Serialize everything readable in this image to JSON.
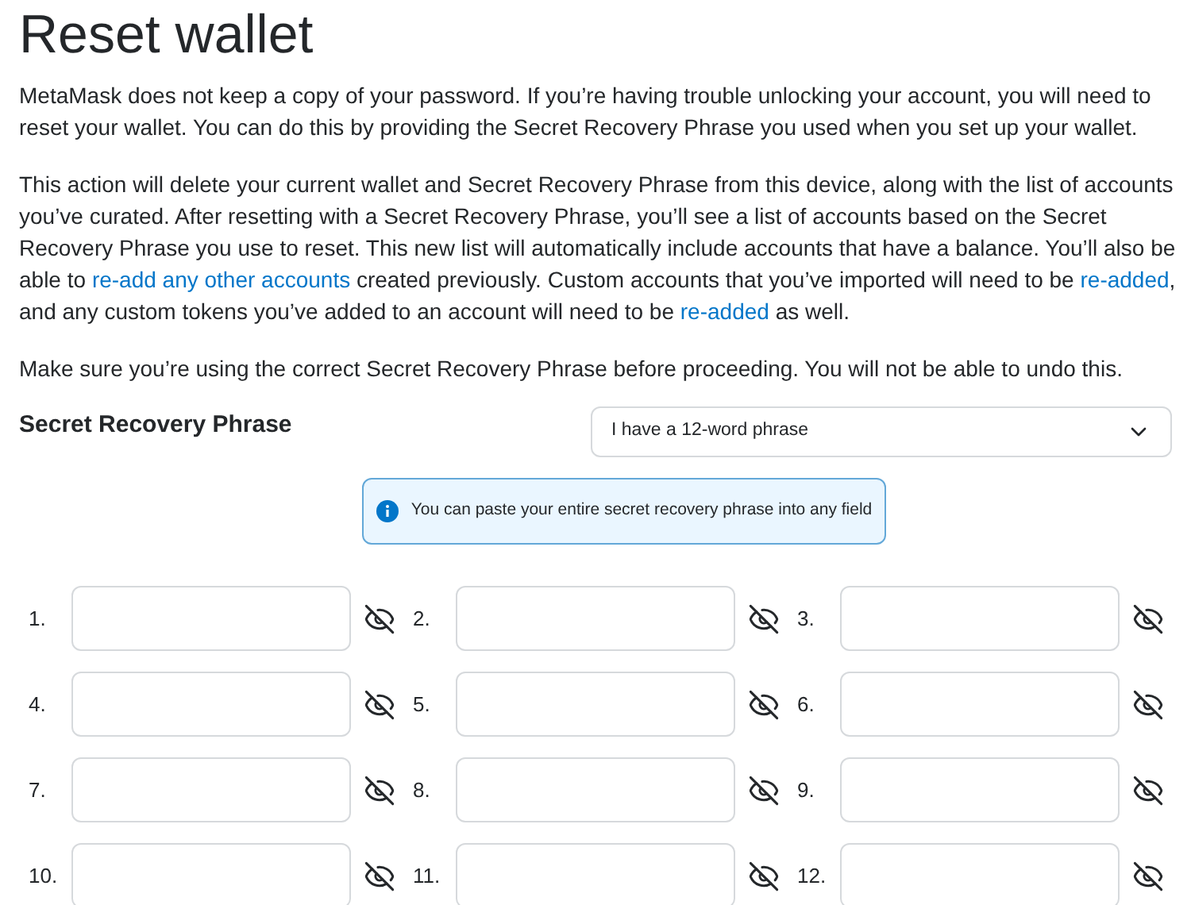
{
  "title": "Reset wallet",
  "paragraphs": [
    [
      {
        "text": "MetaMask does not keep a copy of your password. If you’re having trouble unlocking your account, you will need to reset your wallet. You can do this by providing the Secret Recovery Phrase you used when you set up your wallet.",
        "link": false
      }
    ],
    [
      {
        "text": "This action will delete your current wallet and Secret Recovery Phrase from this device, along with the list of accounts you’ve curated. After resetting with a Secret Recovery Phrase, you’ll see a list of accounts based on the Secret Recovery Phrase you use to reset. This new list will automatically include accounts that have a balance. You’ll also be able to ",
        "link": false
      },
      {
        "text": "re-add any other accounts",
        "link": true
      },
      {
        "text": " created previously. Custom accounts that you’ve imported will need to be ",
        "link": false
      },
      {
        "text": "re-added",
        "link": true
      },
      {
        "text": ", and any custom tokens you’ve added to an account will need to be ",
        "link": false
      },
      {
        "text": "re-added",
        "link": true
      },
      {
        "text": " as well.",
        "link": false
      }
    ],
    [
      {
        "text": "Make sure you’re using the correct Secret Recovery Phrase before proceeding. You will not be able to undo this.",
        "link": false
      }
    ]
  ],
  "phrase_label": "Secret Recovery Phrase",
  "phrase_length_select": {
    "value": "I have a 12-word phrase"
  },
  "info_banner": "You can paste your entire secret recovery phrase into any field",
  "word_fields": [
    {
      "label": "1."
    },
    {
      "label": "2."
    },
    {
      "label": "3."
    },
    {
      "label": "4."
    },
    {
      "label": "5."
    },
    {
      "label": "6."
    },
    {
      "label": "7."
    },
    {
      "label": "8."
    },
    {
      "label": "9."
    },
    {
      "label": "10."
    },
    {
      "label": "11."
    },
    {
      "label": "12."
    }
  ]
}
